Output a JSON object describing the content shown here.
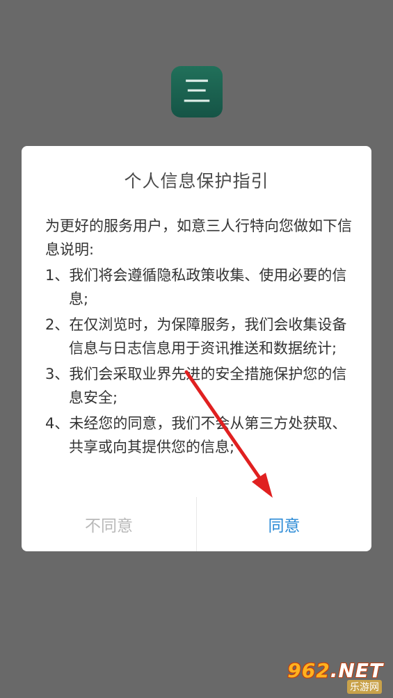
{
  "app": {
    "logo_char": "三"
  },
  "dialog": {
    "title": "个人信息保护指引",
    "intro": "为更好的服务用户，如意三人行特向您做如下信息说明:",
    "items": [
      "1、我们将会遵循隐私政策收集、使用必要的信息;",
      "2、在仅浏览时，为保障服务，我们会收集设备信息与日志信息用于资讯推送和数据统计;",
      "3、我们会采取业界先进的安全措施保护您的信息安全;",
      "4、未经您的同意，我们不会从第三方处获取、共享或向其提供您的信息;"
    ],
    "disagree_label": "不同意",
    "agree_label": "同意"
  },
  "colors": {
    "overlay": "#696969",
    "agree": "#2a8ad6",
    "disagree": "#b8b8b8",
    "arrow": "#e02020",
    "icon_bg": "#1b604f"
  },
  "watermark": {
    "top_num": "962",
    "top_suffix": ".NET",
    "bottom": "乐游网"
  }
}
